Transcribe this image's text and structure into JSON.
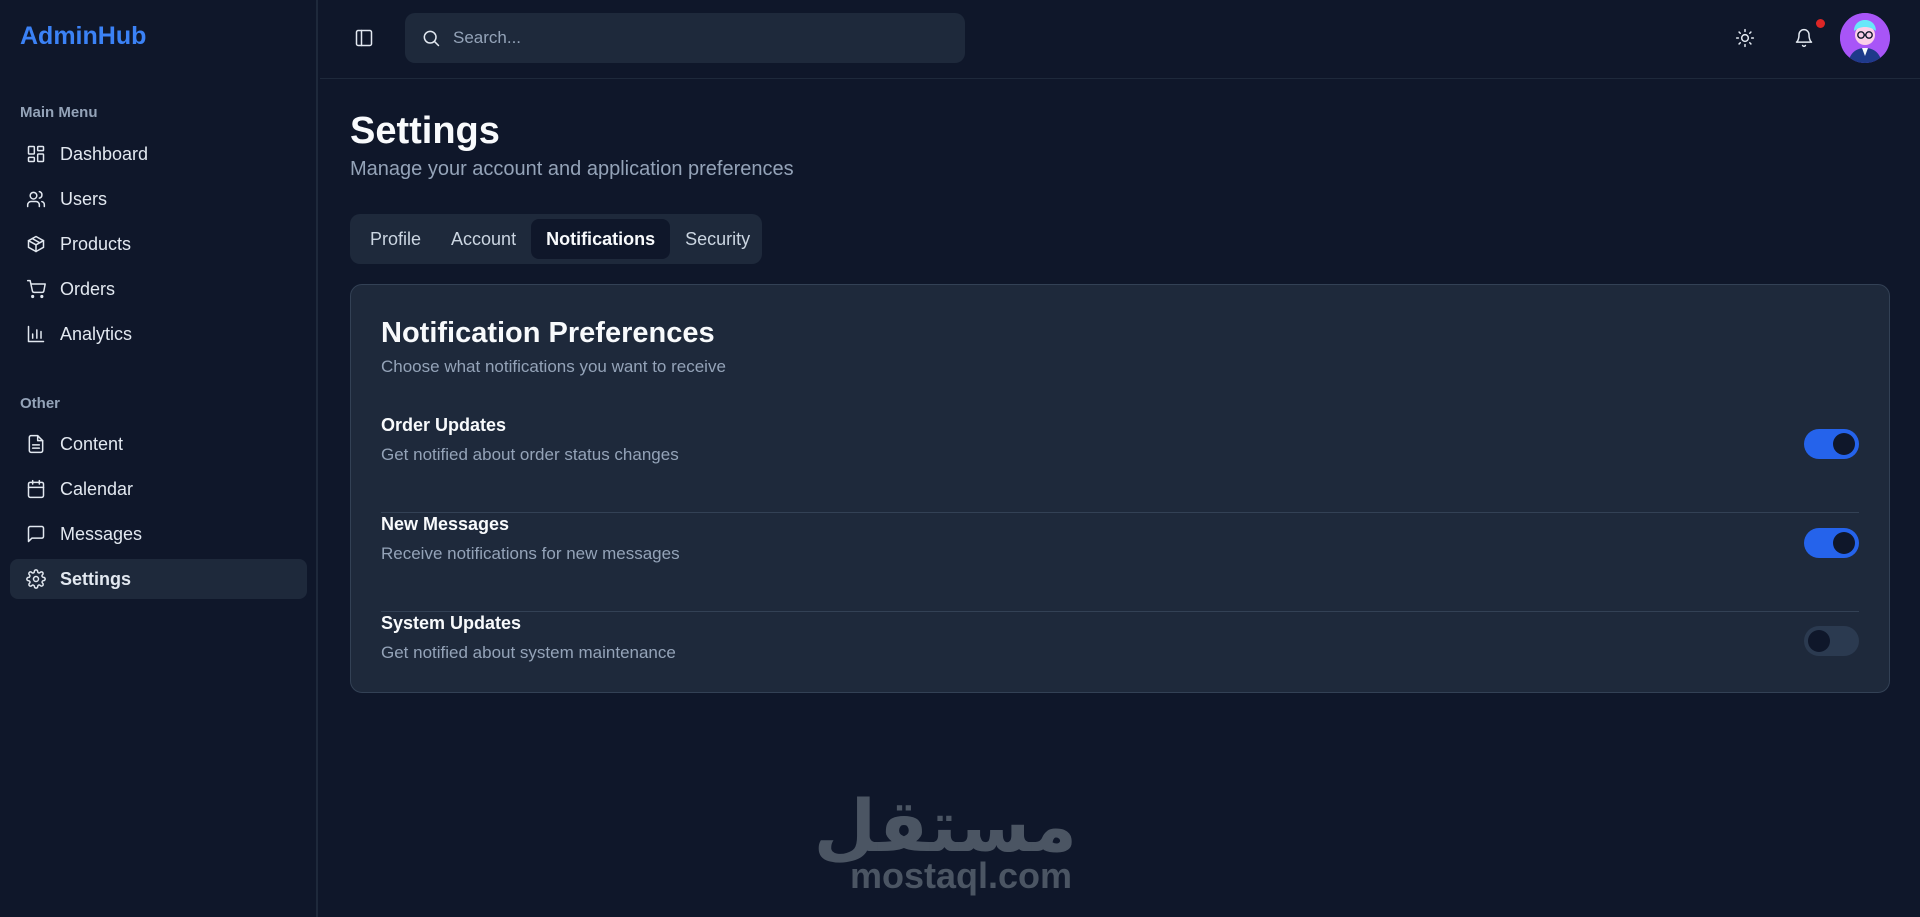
{
  "brand": "AdminHub",
  "sidebar": {
    "main_title": "Main Menu",
    "main_items": [
      {
        "label": "Dashboard",
        "icon": "dashboard-icon"
      },
      {
        "label": "Users",
        "icon": "users-icon"
      },
      {
        "label": "Products",
        "icon": "package-icon"
      },
      {
        "label": "Orders",
        "icon": "cart-icon"
      },
      {
        "label": "Analytics",
        "icon": "bar-chart-icon"
      }
    ],
    "other_title": "Other",
    "other_items": [
      {
        "label": "Content",
        "icon": "file-icon"
      },
      {
        "label": "Calendar",
        "icon": "calendar-icon"
      },
      {
        "label": "Messages",
        "icon": "message-icon"
      },
      {
        "label": "Settings",
        "icon": "gear-icon",
        "active": true
      }
    ]
  },
  "header": {
    "search_placeholder": "Search...",
    "icons": [
      "sidebar-toggle-icon",
      "search-icon",
      "sun-icon",
      "bell-icon"
    ],
    "has_notification": true
  },
  "page": {
    "title": "Settings",
    "subtitle": "Manage your account and application preferences"
  },
  "tabs": [
    {
      "label": "Profile"
    },
    {
      "label": "Account"
    },
    {
      "label": "Notifications",
      "active": true
    },
    {
      "label": "Security"
    }
  ],
  "card": {
    "title": "Notification Preferences",
    "description": "Choose what notifications you want to receive",
    "preferences": [
      {
        "title": "Order Updates",
        "description": "Get notified about order status changes",
        "enabled": true
      },
      {
        "title": "New Messages",
        "description": "Receive notifications for new messages",
        "enabled": true
      },
      {
        "title": "System Updates",
        "description": "Get notified about system maintenance",
        "enabled": false
      }
    ]
  },
  "watermark": {
    "arabic": "مستقل",
    "latin": "mostaql.com"
  },
  "colors": {
    "background": "#0f172a",
    "surface": "#1e293b",
    "accent": "#3b82f6",
    "toggle_on": "#2563eb",
    "muted_text": "#94a3b8",
    "notification_dot": "#dc2626"
  }
}
